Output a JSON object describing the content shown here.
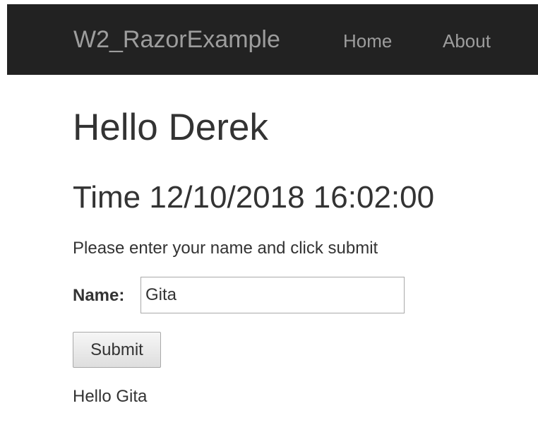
{
  "navbar": {
    "brand": "W2_RazorExample",
    "links": [
      {
        "label": "Home"
      },
      {
        "label": "About"
      }
    ]
  },
  "main": {
    "heading": "Hello Derek",
    "time_line": "Time 12/10/2018 16:02:00",
    "instructions": "Please enter your name and click submit",
    "form": {
      "name_label": "Name:",
      "name_value": "Gita",
      "submit_label": "Submit"
    },
    "greeting": "Hello Gita"
  },
  "colors": {
    "navbar_background": "#222222",
    "nav_text": "#9d9d9d",
    "body_text": "#333333"
  }
}
